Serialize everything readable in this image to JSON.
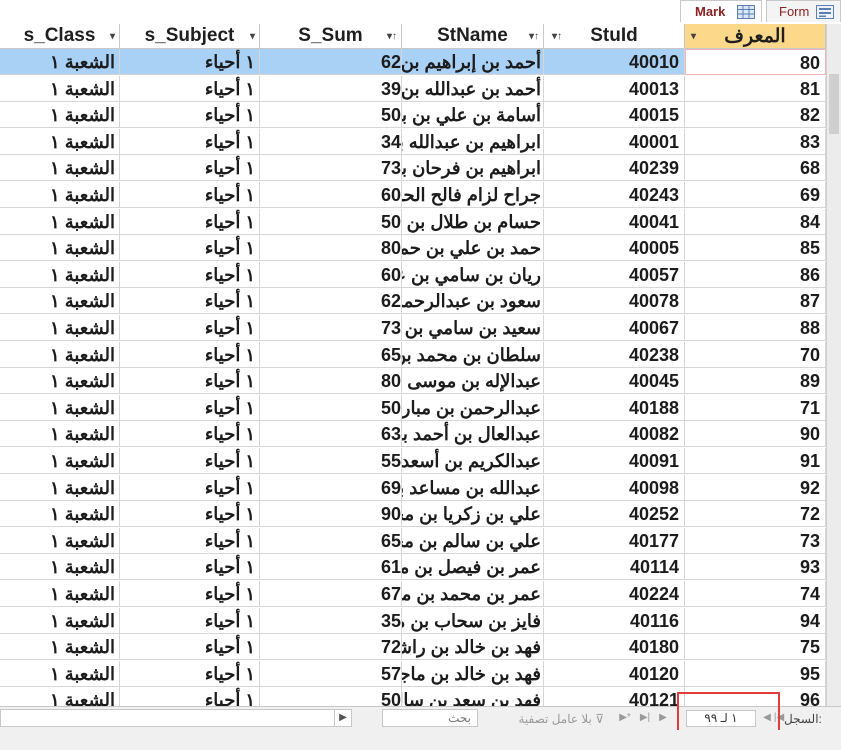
{
  "tabs": [
    {
      "label": "Mark",
      "icon": "datasheet-icon"
    },
    {
      "label": "Form",
      "icon": "form-icon"
    }
  ],
  "columns": {
    "id": "المعرف",
    "stuid": "StuId",
    "name": "StName",
    "sum": "S_Sum",
    "subject": "s_Subject",
    "class": "s_Class"
  },
  "rows": [
    {
      "id": "80",
      "stuid": "40010",
      "name": "أحمد بن إبراهيم بن ع",
      "sum": "62",
      "subject": "١ أحياء",
      "class": "الشعبة ١"
    },
    {
      "id": "81",
      "stuid": "40013",
      "name": "أحمد بن عبدالله بن ع",
      "sum": "39",
      "subject": "١ أحياء",
      "class": "الشعبة ١"
    },
    {
      "id": "82",
      "stuid": "40015",
      "name": "أسامة بن علي بن بط",
      "sum": "50",
      "subject": "١ أحياء",
      "class": "الشعبة ١"
    },
    {
      "id": "83",
      "stuid": "40001",
      "name": "ابراهيم بن عبدالله بن",
      "sum": "34",
      "subject": "١ أحياء",
      "class": "الشعبة ١"
    },
    {
      "id": "68",
      "stuid": "40239",
      "name": "ابراهيم بن فرحان بن",
      "sum": "73",
      "subject": "١ أحياء",
      "class": "الشعبة ١"
    },
    {
      "id": "69",
      "stuid": "40243",
      "name": "جراح لزام فالح الحري",
      "sum": "60",
      "subject": "١ أحياء",
      "class": "الشعبة ١"
    },
    {
      "id": "84",
      "stuid": "40041",
      "name": "حسام بن طلال بن حـ",
      "sum": "50",
      "subject": "١ أحياء",
      "class": "الشعبة ١"
    },
    {
      "id": "85",
      "stuid": "40005",
      "name": "حمد بن علي بن حمد",
      "sum": "80",
      "subject": "١ أحياء",
      "class": "الشعبة ١"
    },
    {
      "id": "86",
      "stuid": "40057",
      "name": "ريان بن سامي بن عـ",
      "sum": "60",
      "subject": "١ أحياء",
      "class": "الشعبة ١"
    },
    {
      "id": "87",
      "stuid": "40078",
      "name": "سعود بن عبدالرحمن",
      "sum": "62",
      "subject": "١ أحياء",
      "class": "الشعبة ١"
    },
    {
      "id": "88",
      "stuid": "40067",
      "name": "سعيد بن سامي بن يـ",
      "sum": "73",
      "subject": "١ أحياء",
      "class": "الشعبة ١"
    },
    {
      "id": "70",
      "stuid": "40238",
      "name": "سلطان بن محمد بن",
      "sum": "65",
      "subject": "١ أحياء",
      "class": "الشعبة ١"
    },
    {
      "id": "89",
      "stuid": "40045",
      "name": "عبدالإله بن موسى بن",
      "sum": "80",
      "subject": "١ أحياء",
      "class": "الشعبة ١"
    },
    {
      "id": "71",
      "stuid": "40188",
      "name": "عبدالرحمن بن مبارك",
      "sum": "50",
      "subject": "١ أحياء",
      "class": "الشعبة ١"
    },
    {
      "id": "90",
      "stuid": "40082",
      "name": "عبدالعال بن أحمد بن",
      "sum": "63",
      "subject": "١ أحياء",
      "class": "الشعبة ١"
    },
    {
      "id": "91",
      "stuid": "40091",
      "name": "عبدالكريم بن أسعد بن",
      "sum": "55",
      "subject": "١ أحياء",
      "class": "الشعبة ١"
    },
    {
      "id": "92",
      "stuid": "40098",
      "name": "عبدالله بن مساعد بن",
      "sum": "69",
      "subject": "١ أحياء",
      "class": "الشعبة ١"
    },
    {
      "id": "72",
      "stuid": "40252",
      "name": "علي بن زكريا بن محـ",
      "sum": "90",
      "subject": "١ أحياء",
      "class": "الشعبة ١"
    },
    {
      "id": "73",
      "stuid": "40177",
      "name": "علي بن سالم بن محـ",
      "sum": "65",
      "subject": "١ أحياء",
      "class": "الشعبة ١"
    },
    {
      "id": "93",
      "stuid": "40114",
      "name": "عمر بن فيصل بن مبـ",
      "sum": "61",
      "subject": "١ أحياء",
      "class": "الشعبة ١"
    },
    {
      "id": "74",
      "stuid": "40224",
      "name": "عمر بن محمد بن معـ",
      "sum": "67",
      "subject": "١ أحياء",
      "class": "الشعبة ١"
    },
    {
      "id": "94",
      "stuid": "40116",
      "name": "فايز بن سحاب بن مـ",
      "sum": "35",
      "subject": "١ أحياء",
      "class": "الشعبة ١"
    },
    {
      "id": "75",
      "stuid": "40180",
      "name": "فهد بن خالد بن راشد",
      "sum": "72",
      "subject": "١ أحياء",
      "class": "الشعبة ١"
    },
    {
      "id": "95",
      "stuid": "40120",
      "name": "فهد بن خالد بن ماجد",
      "sum": "57",
      "subject": "١ أحياء",
      "class": "الشعبة ١"
    },
    {
      "id": "96",
      "stuid": "40121",
      "name": "فهد بن سعد بن سالم",
      "sum": "50",
      "subject": "١ أحياء",
      "class": "الشعبة ١"
    }
  ],
  "navigator": {
    "record_label": "السجل:",
    "record_value": "١ لـ ٩٩",
    "filter_label": "بلا عامل تصفية",
    "search_placeholder": "بحث"
  }
}
